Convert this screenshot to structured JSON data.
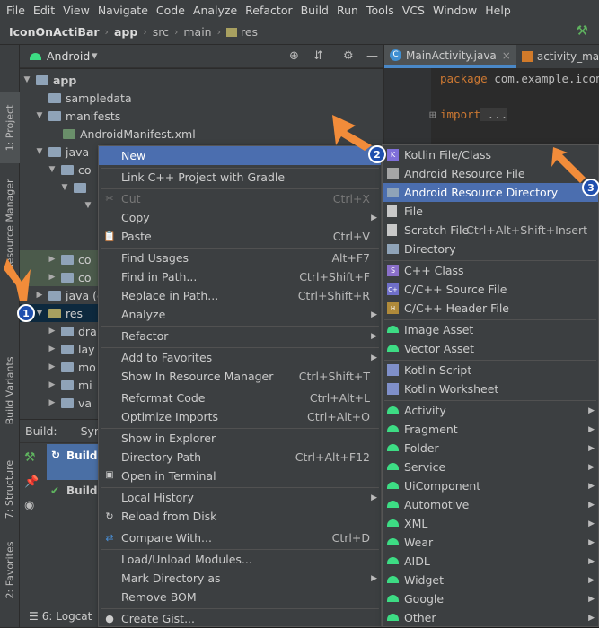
{
  "menubar": {
    "items": [
      "File",
      "Edit",
      "View",
      "Navigate",
      "Code",
      "Analyze",
      "Refactor",
      "Build",
      "Run",
      "Tools",
      "VCS",
      "Window",
      "Help"
    ]
  },
  "navbar": {
    "crumbs": [
      "IconOnActiBar",
      "app",
      "src",
      "main",
      "res"
    ]
  },
  "left_tabs": {
    "project": "1: Project",
    "resource": "Resource Manager",
    "build_variants": "Build Variants",
    "structure": "7: Structure",
    "favorites": "2: Favorites"
  },
  "project": {
    "view": "Android"
  },
  "tree": {
    "app": "app",
    "sampledata": "sampledata",
    "manifests": "manifests",
    "manifest_file": "AndroidManifest.xml",
    "java": "java",
    "co1": "co",
    "co2": "co",
    "co3": "co",
    "java_gen": "java (c",
    "res": "res",
    "dra": "dra",
    "lay": "lay",
    "mo": "mo",
    "mi": "mi",
    "va": "va"
  },
  "build": {
    "title": "Build:",
    "sync": "Sync",
    "item1": "Build: r",
    "item2": "Build: f"
  },
  "bottom": {
    "logcat": "6: Logcat"
  },
  "editor": {
    "tab1": "MainActivity.java",
    "tab2": "activity_main",
    "line1_kw": "package",
    "line1_rest": " com.example.iconor",
    "line2_kw": "import",
    "line2_rest": " ..."
  },
  "context_menu": {
    "new": "New",
    "link_cpp": "Link C++ Project with Gradle",
    "cut": "Cut",
    "cut_sc": "Ctrl+X",
    "copy": "Copy",
    "paste": "Paste",
    "paste_sc": "Ctrl+V",
    "find_usages": "Find Usages",
    "find_usages_sc": "Alt+F7",
    "find_in_path": "Find in Path...",
    "find_in_path_sc": "Ctrl+Shift+F",
    "replace_in_path": "Replace in Path...",
    "replace_in_path_sc": "Ctrl+Shift+R",
    "analyze": "Analyze",
    "refactor": "Refactor",
    "add_favorites": "Add to Favorites",
    "show_resource": "Show In Resource Manager",
    "show_resource_sc": "Ctrl+Shift+T",
    "reformat": "Reformat Code",
    "reformat_sc": "Ctrl+Alt+L",
    "optimize": "Optimize Imports",
    "optimize_sc": "Ctrl+Alt+O",
    "show_explorer": "Show in Explorer",
    "dir_path": "Directory Path",
    "dir_path_sc": "Ctrl+Alt+F12",
    "open_terminal": "Open in Terminal",
    "local_history": "Local History",
    "reload": "Reload from Disk",
    "compare": "Compare With...",
    "compare_sc": "Ctrl+D",
    "load_modules": "Load/Unload Modules...",
    "mark_dir": "Mark Directory as",
    "remove_bom": "Remove BOM",
    "create_gist": "Create Gist..."
  },
  "new_submenu": {
    "kotlin_file": "Kotlin File/Class",
    "android_res_file": "Android Resource File",
    "android_res_dir": "Android Resource Directory",
    "file": "File",
    "scratch": "Scratch File",
    "scratch_sc": "Ctrl+Alt+Shift+Insert",
    "directory": "Directory",
    "cpp_class": "C++ Class",
    "cpp_source": "C/C++ Source File",
    "cpp_header": "C/C++ Header File",
    "image_asset": "Image Asset",
    "vector_asset": "Vector Asset",
    "kotlin_script": "Kotlin Script",
    "kotlin_worksheet": "Kotlin Worksheet",
    "activity": "Activity",
    "fragment": "Fragment",
    "folder": "Folder",
    "service": "Service",
    "uicomponent": "UiComponent",
    "automotive": "Automotive",
    "xml": "XML",
    "wear": "Wear",
    "aidl": "AIDL",
    "widget": "Widget",
    "google": "Google",
    "other": "Other"
  },
  "callouts": [
    "1",
    "2",
    "3"
  ],
  "colors": {
    "highlight": "#4b6eaf",
    "callout": "#1f4fae",
    "arrow": "#f28c3a",
    "android": "#3ddc84"
  }
}
